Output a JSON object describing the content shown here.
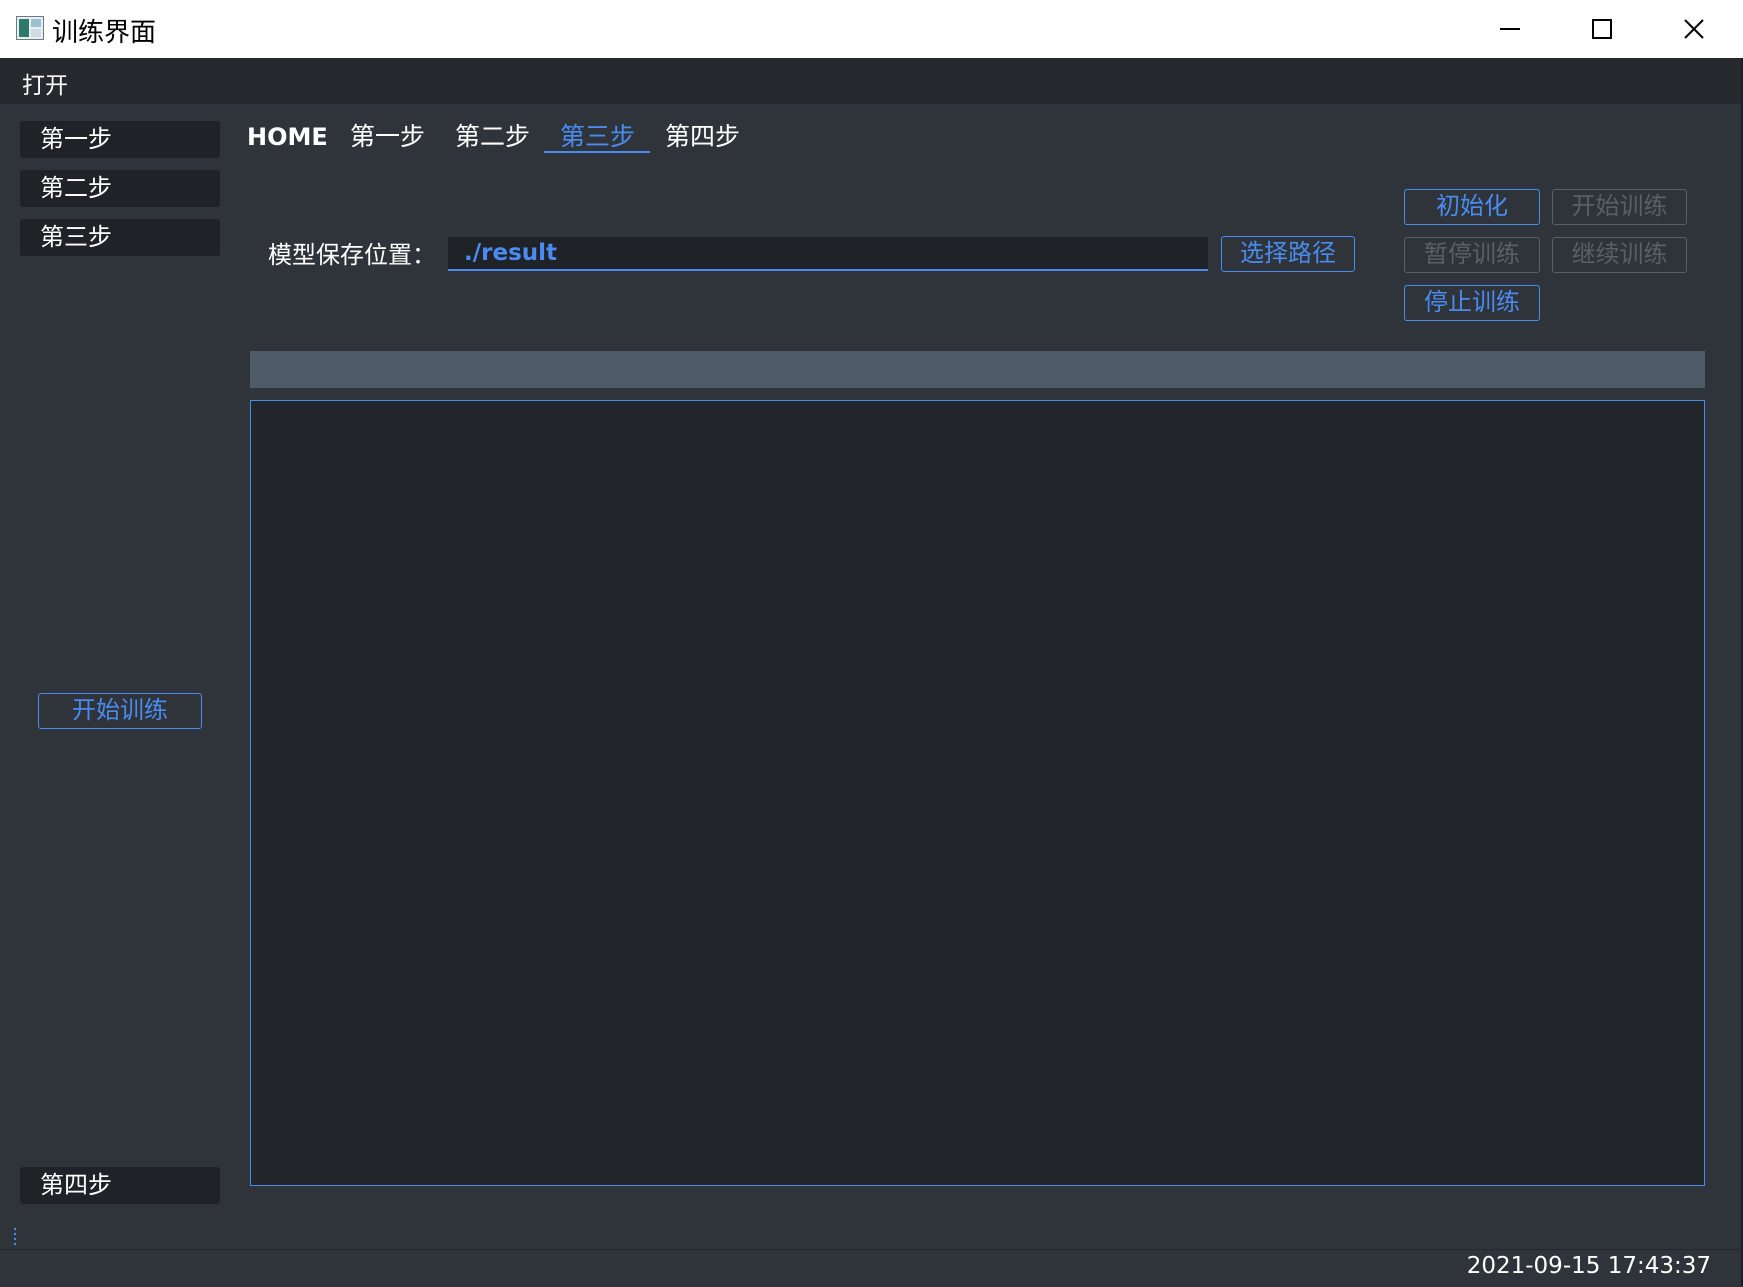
{
  "window": {
    "title": "训练界面"
  },
  "menubar": {
    "items": [
      {
        "label": "打开"
      }
    ]
  },
  "sidebar": {
    "items": [
      {
        "label": "第一步"
      },
      {
        "label": "第二步"
      },
      {
        "label": "第三步"
      }
    ],
    "start_button": "开始训练",
    "bottom_item": "第四步"
  },
  "tabs": {
    "items": [
      {
        "label": "HOME"
      },
      {
        "label": "第一步"
      },
      {
        "label": "第二步"
      },
      {
        "label": "第三步"
      },
      {
        "label": "第四步"
      }
    ],
    "active_index": 3
  },
  "save_path": {
    "label": "模型保存位置：",
    "value": "./result",
    "browse_button": "选择路径"
  },
  "controls": {
    "init": "初始化",
    "start": "开始训练",
    "pause": "暂停训练",
    "resume": "继续训练",
    "stop": "停止训练"
  },
  "progress": {
    "value": 0
  },
  "statusbar": {
    "datetime": "2021-09-15 17:43:37"
  },
  "colors": {
    "accent": "#4a8bf0",
    "background": "#2f343a",
    "disabled": "#5a5f66"
  }
}
